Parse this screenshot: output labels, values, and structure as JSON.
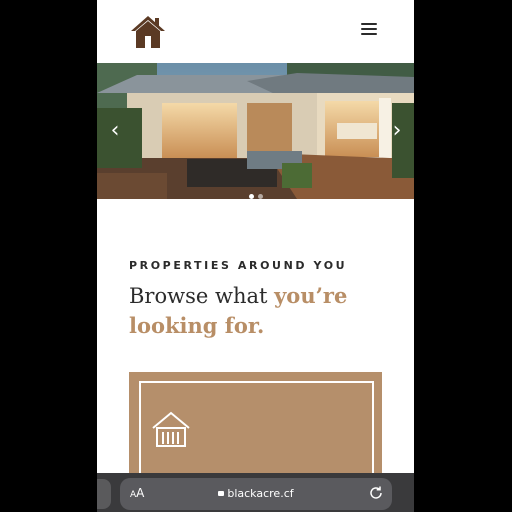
{
  "header": {
    "logo_icon": "house-icon",
    "menu_icon": "hamburger-menu-icon"
  },
  "hero": {
    "prev_icon": "chevron-left-icon",
    "next_icon": "chevron-right-icon",
    "prev_glyph": "‹",
    "next_glyph": "›",
    "slide_count": 2,
    "active_slide": 1
  },
  "section": {
    "eyebrow": "PROPERTIES AROUND YOU",
    "headline_plain": "Browse what ",
    "headline_accent": "you’re looking for."
  },
  "card": {
    "icon": "building-columns-icon",
    "color": "#b58f6b"
  },
  "browser": {
    "aa_small": "A",
    "aa_large": "A",
    "url": "blackacre.cf",
    "reload_icon": "reload-icon"
  },
  "colors": {
    "brand_brown": "#5b3a24",
    "accent_tan": "#b88e66",
    "text_dark": "#2b2b2b"
  }
}
